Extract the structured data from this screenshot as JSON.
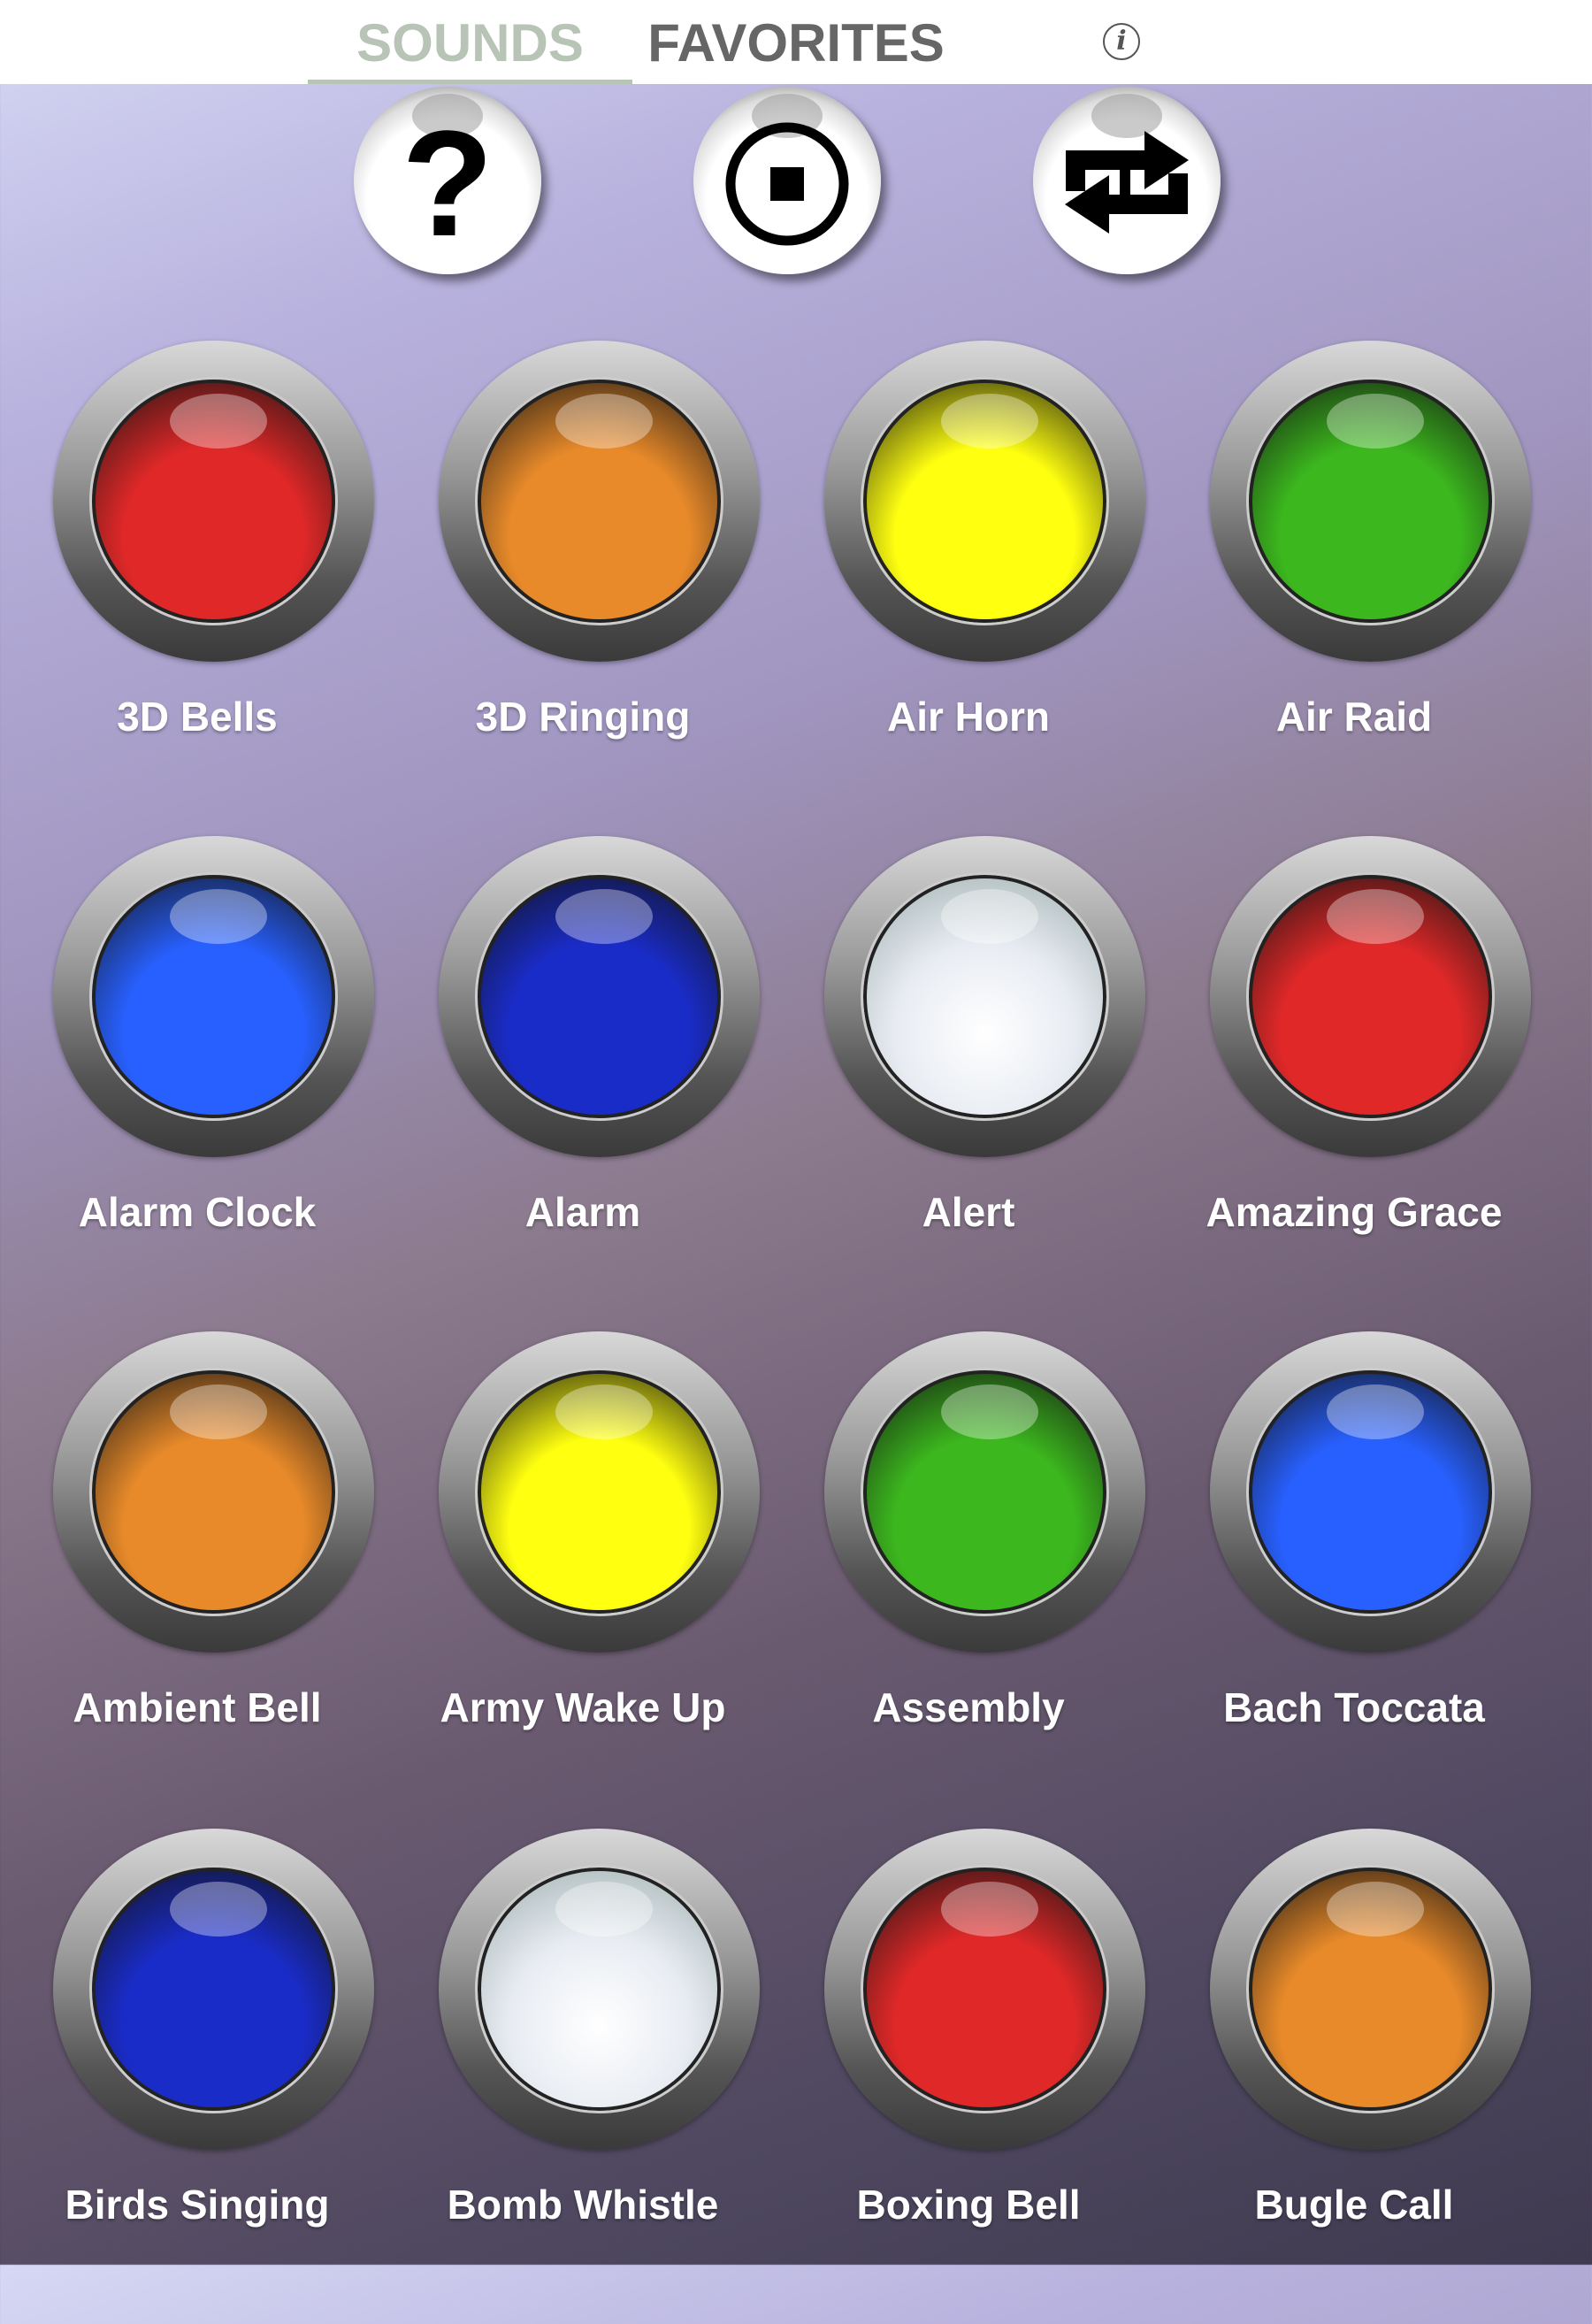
{
  "tabs": {
    "sounds": "SOUNDS",
    "favorites": "FAVORITES",
    "active": "SOUNDS",
    "info_icon": "i"
  },
  "toolbar": {
    "help_icon": "?",
    "stop_icon": "stop-circle",
    "repeat_icon": "repeat"
  },
  "colors": {
    "red": "#e02828",
    "orange": "#e88a2a",
    "yellow": "#ffff10",
    "green": "#3cb81e",
    "blue": "#2860ff",
    "darkblue": "#1a2cc8",
    "white": "#f4f6fa"
  },
  "sounds": [
    {
      "label": "3D Bells",
      "color": "red"
    },
    {
      "label": "3D Ringing",
      "color": "orange"
    },
    {
      "label": "Air Horn",
      "color": "yellow"
    },
    {
      "label": "Air Raid",
      "color": "green"
    },
    {
      "label": "Alarm Clock",
      "color": "blue"
    },
    {
      "label": "Alarm",
      "color": "darkblue"
    },
    {
      "label": "Alert",
      "color": "white"
    },
    {
      "label": "Amazing Grace",
      "color": "red"
    },
    {
      "label": "Ambient Bell",
      "color": "orange"
    },
    {
      "label": "Army Wake Up",
      "color": "yellow"
    },
    {
      "label": "Assembly",
      "color": "green"
    },
    {
      "label": "Bach Toccata",
      "color": "blue"
    },
    {
      "label": "Birds Singing",
      "color": "darkblue"
    },
    {
      "label": "Bomb Whistle",
      "color": "white"
    },
    {
      "label": "Boxing Bell",
      "color": "red"
    },
    {
      "label": "Bugle Call",
      "color": "orange"
    }
  ]
}
